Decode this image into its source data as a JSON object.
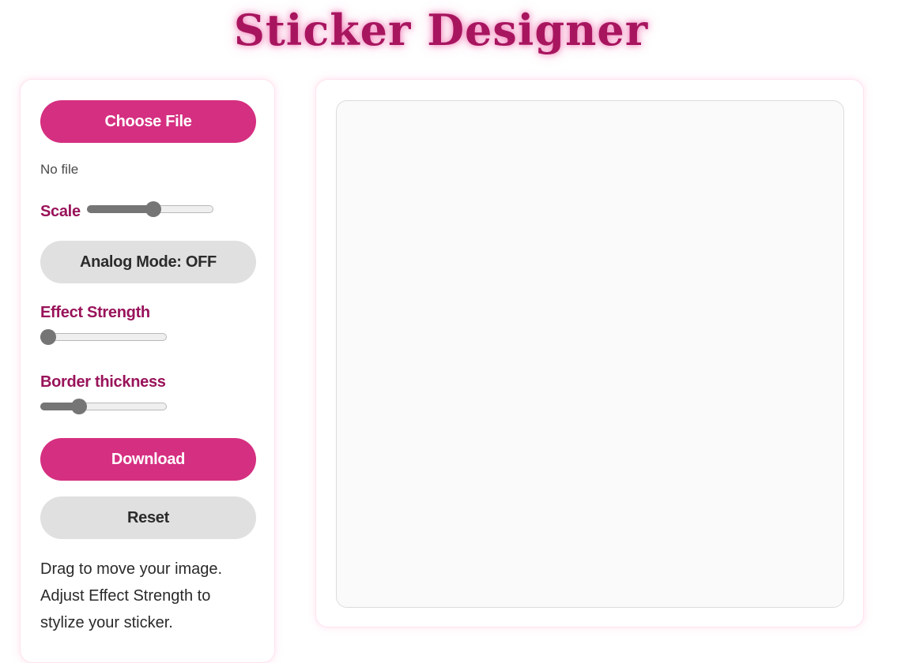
{
  "app": {
    "title": "Sticker Designer",
    "accent_color": "#d52f81",
    "label_color": "#99135a"
  },
  "controls": {
    "choose_file_label": "Choose File",
    "file_status": "No file",
    "scale": {
      "label": "Scale",
      "value": 0.53
    },
    "analog_mode_label": "Analog Mode: OFF",
    "effect_strength": {
      "label": "Effect Strength",
      "value": 0.0
    },
    "border_thickness": {
      "label": "Border thickness",
      "value": 0.28
    },
    "download_label": "Download",
    "reset_label": "Reset"
  },
  "help": {
    "lines": [
      "Drag to move your image.",
      "Adjust Effect Strength to",
      "stylize your sticker."
    ]
  }
}
